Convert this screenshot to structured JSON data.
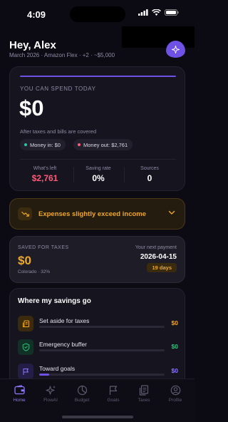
{
  "status_bar": {
    "time": "4:09"
  },
  "header": {
    "greeting": "Hey, Alex",
    "subtitle": "March 2026 · Amazon Flex · +2 · ~$5,000"
  },
  "spend": {
    "label": "YOU CAN SPEND TODAY",
    "value": "$0",
    "note": "After taxes and bills are covered",
    "money_in": "Money in: $0",
    "money_out": "Money out: $2,761",
    "stats": [
      {
        "label": "What's left",
        "value": "$2,761",
        "color": "#ff5a7a"
      },
      {
        "label": "Saving rate",
        "value": "0%",
        "color": "#ffffff"
      },
      {
        "label": "Sources",
        "value": "0",
        "color": "#ffffff"
      }
    ]
  },
  "alert": {
    "text": "Expenses slightly exceed income",
    "icon": "trend-down-icon"
  },
  "taxes": {
    "label": "SAVED FOR TAXES",
    "value": "$0",
    "location": "Colorado · 32%",
    "next_payment_label": "Your next payment",
    "next_payment_date": "2026-04-15",
    "days_badge": "19 days"
  },
  "savings": {
    "title": "Where my savings go",
    "rows": [
      {
        "name": "Set aside for taxes",
        "amount": "$0",
        "color": "#f0a726",
        "icon": "receipt-icon",
        "progress": 0
      },
      {
        "name": "Emergency buffer",
        "amount": "$0",
        "color": "#2ec27e",
        "icon": "shield-icon",
        "progress": 0
      },
      {
        "name": "Toward goals",
        "amount": "$0",
        "color": "#6f51e6",
        "icon": "flag-icon",
        "progress": 0.08
      }
    ]
  },
  "tabs": [
    {
      "label": "Home",
      "icon": "wallet-icon",
      "active": true
    },
    {
      "label": "FlowAI",
      "icon": "sparkle-icon",
      "active": false
    },
    {
      "label": "Budget",
      "icon": "pie-icon",
      "active": false
    },
    {
      "label": "Goals",
      "icon": "flag-icon",
      "active": false
    },
    {
      "label": "Taxes",
      "icon": "document-icon",
      "active": false
    },
    {
      "label": "Profile",
      "icon": "person-icon",
      "active": false
    }
  ],
  "colors": {
    "accent": "#6f51e6",
    "warning": "#f0a726",
    "negative": "#ff5a7a",
    "positive": "#2ec27e"
  }
}
